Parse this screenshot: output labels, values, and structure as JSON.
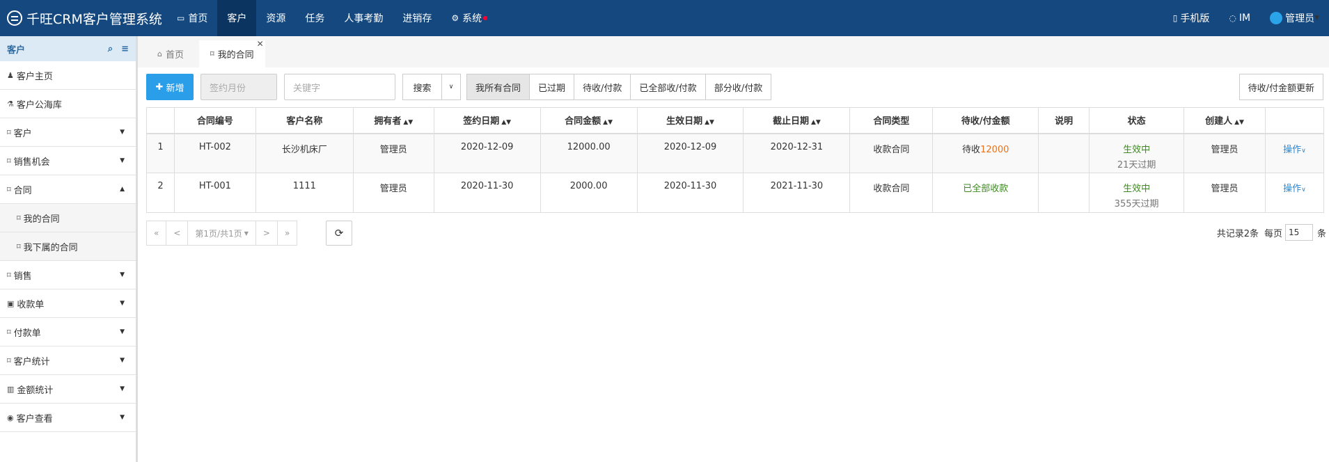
{
  "app": {
    "title": "千旺CRM客户管理系统"
  },
  "nav": [
    {
      "label": "首页",
      "icon": "monitor-icon"
    },
    {
      "label": "客户"
    },
    {
      "label": "资源"
    },
    {
      "label": "任务"
    },
    {
      "label": "人事考勤"
    },
    {
      "label": "进销存"
    },
    {
      "label": "系统",
      "icon": "gear-icon"
    }
  ],
  "topright": {
    "mobile": "手机版",
    "im": "IM",
    "user": "管理员"
  },
  "sidebar": {
    "title": "客户",
    "items": [
      {
        "label": "客户主页"
      },
      {
        "label": "客户公海库"
      },
      {
        "label": "客户"
      },
      {
        "label": "销售机会"
      },
      {
        "label": "合同"
      },
      {
        "label": "我的合同"
      },
      {
        "label": "我下属的合同"
      },
      {
        "label": "销售"
      },
      {
        "label": "收款单"
      },
      {
        "label": "付款单"
      },
      {
        "label": "客户统计"
      },
      {
        "label": "金额统计"
      },
      {
        "label": "客户查看"
      }
    ]
  },
  "tabs": [
    {
      "label": "首页"
    },
    {
      "label": "我的合同"
    }
  ],
  "toolbar": {
    "add": "新增",
    "sign_month_placeholder": "签约月份",
    "keyword_placeholder": "关键字",
    "search": "搜索",
    "filters": [
      "我所有合同",
      "已过期",
      "待收/付款",
      "已全部收/付款",
      "部分收/付款"
    ],
    "update": "待收/付金额更新"
  },
  "table": {
    "headers": [
      "合同编号",
      "客户名称",
      "拥有者",
      "签约日期",
      "合同金额",
      "生效日期",
      "截止日期",
      "合同类型",
      "待收/付金额",
      "说明",
      "状态",
      "创建人"
    ],
    "rows": [
      {
        "idx": "1",
        "no": "HT-002",
        "customer": "长沙机床厂",
        "owner": "管理员",
        "sign": "2020-12-09",
        "amount": "12000.00",
        "start": "2020-12-09",
        "end": "2020-12-31",
        "type": "收款合同",
        "pending_prefix": "待收",
        "pending_value": "12000",
        "note": "",
        "status": "生效中",
        "status_sub": "21天过期",
        "creator": "管理员",
        "op": "操作"
      },
      {
        "idx": "2",
        "no": "HT-001",
        "customer": "1111",
        "owner": "管理员",
        "sign": "2020-11-30",
        "amount": "2000.00",
        "start": "2020-11-30",
        "end": "2021-11-30",
        "type": "收款合同",
        "pending_done": "已全部收款",
        "note": "",
        "status": "生效中",
        "status_sub": "355天过期",
        "creator": "管理员",
        "op": "操作"
      }
    ]
  },
  "pager": {
    "first": "«",
    "prev": "<",
    "page": "第1页/共1页",
    "next": ">",
    "last": "»",
    "total": "共记录2条",
    "per_page_label": "每页",
    "per_page": "15",
    "unit": "条"
  }
}
